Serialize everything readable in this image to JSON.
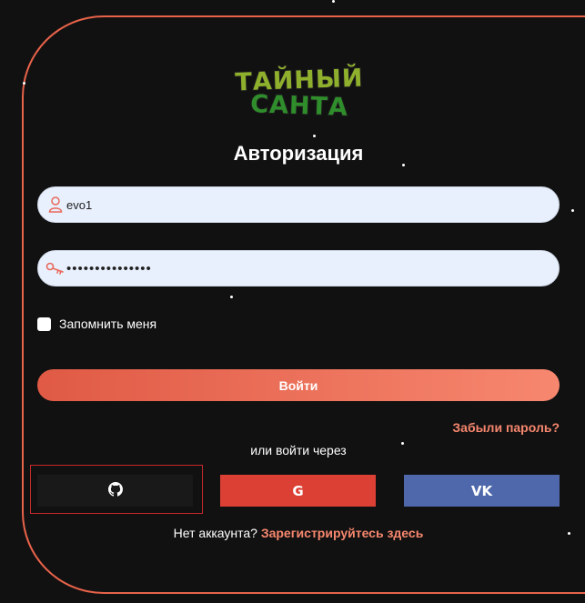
{
  "logo": {
    "line1": "ТАЙНЫЙ",
    "line2": "САНТА"
  },
  "title": "Авторизация",
  "login_field": {
    "value": "evo1",
    "icon": "user-icon"
  },
  "password_field": {
    "value": "•••••••••••••••",
    "icon": "key-icon"
  },
  "remember": {
    "label": "Запомнить меня",
    "checked": false
  },
  "login_button": {
    "label": "Войти"
  },
  "forgot_link": "Забыли пароль?",
  "or_text": "или войти через",
  "social": [
    {
      "name": "github",
      "icon": "github-icon",
      "color": "#1a1919"
    },
    {
      "name": "google",
      "icon": "google-icon",
      "glyph": "G",
      "color": "#dc4034"
    },
    {
      "name": "vk",
      "icon": "vk-icon",
      "glyph": "VK",
      "color": "#4e68ab"
    }
  ],
  "register": {
    "prefix": "Нет аккаунта?",
    "link": "Зарегистрируйтесь здесь"
  },
  "colors": {
    "accent": "#e8634a",
    "link": "#f6876e",
    "background": "#121111"
  }
}
